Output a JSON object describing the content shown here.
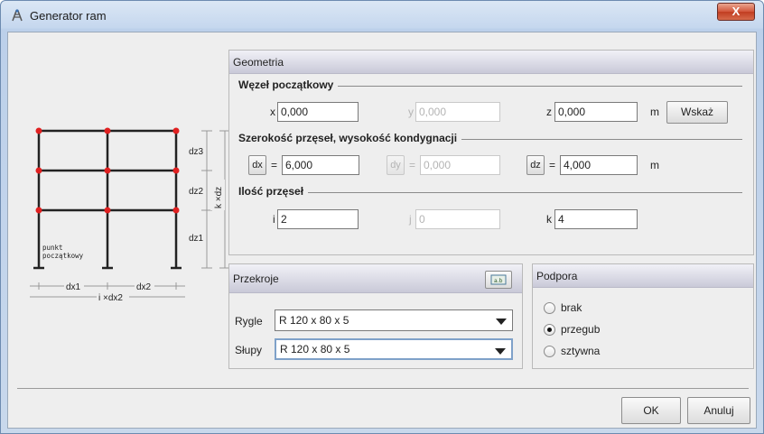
{
  "window": {
    "title": "Generator ram",
    "close_label": "X"
  },
  "diagram": {
    "dz_labels": [
      "dz3",
      "dz2",
      "dz1"
    ],
    "k_dz_label": "k ×dz",
    "dx_labels": [
      "dx1",
      "dx2"
    ],
    "i_dx_label": "i ×dx2",
    "start_point_label": [
      "punkt",
      "początkowy"
    ]
  },
  "geometria": {
    "header": "Geometria",
    "wezel": {
      "title": "Węzeł początkowy",
      "x_label": "x",
      "x_value": "0,000",
      "y_label": "y",
      "y_value": "0,000",
      "z_label": "z",
      "z_value": "0,000",
      "unit": "m",
      "wskaz_label": "Wskaż"
    },
    "szerokosc": {
      "title": "Szerokość przęseł, wysokość kondygnacji",
      "dx_button": "dx",
      "dx_value": "6,000",
      "dy_button": "dy",
      "dy_value": "0,000",
      "dz_button": "dz",
      "dz_value": "4,000",
      "eq": "=",
      "unit": "m"
    },
    "ilosc": {
      "title": "Ilość przęseł",
      "i_label": "i",
      "i_value": "2",
      "j_label": "j",
      "j_value": "0",
      "k_label": "k",
      "k_value": "4"
    }
  },
  "przekroje": {
    "header": "Przekroje",
    "rygle_label": "Rygle",
    "rygle_value": "R 120 x 80 x 5",
    "slupy_label": "Słupy",
    "slupy_value": "R 120 x 80 x 5"
  },
  "podpora": {
    "header": "Podpora",
    "options": [
      "brak",
      "przegub",
      "sztywna"
    ],
    "selected": "przegub"
  },
  "footer": {
    "ok_label": "OK",
    "cancel_label": "Anuluj"
  },
  "colors": {
    "node": "#e02020",
    "frame": "#222222",
    "accent": "#c13d21"
  }
}
